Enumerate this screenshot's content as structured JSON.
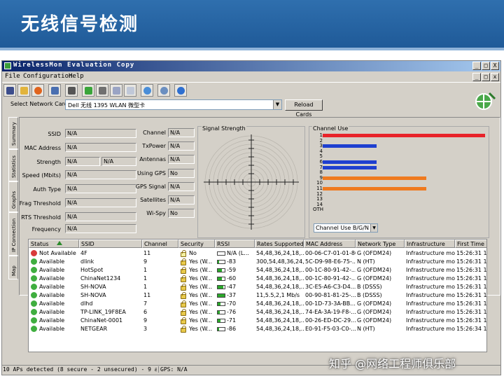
{
  "banner": {
    "title": "无线信号检测"
  },
  "window": {
    "title": "WirelessMon Evaluation Copy",
    "controls": [
      "_",
      "□",
      "X"
    ]
  },
  "menu": {
    "items": [
      "File",
      "Configuration",
      "Help"
    ]
  },
  "network_card": {
    "label": "Select Network Card",
    "value": "Dell 无线 1395 WLAN 微型卡",
    "reload_label": "Reload Cards"
  },
  "tabs": [
    "Summary",
    "Statistics",
    "Graphs",
    "IP Connection",
    "Map"
  ],
  "summary": {
    "left_fields": [
      {
        "label": "SSID",
        "value": "N/A"
      },
      {
        "label": "MAC Address",
        "value": "N/A"
      },
      {
        "label": "Strength",
        "value": "N/A",
        "value2": "N/A"
      },
      {
        "label": "Speed (Mbits)",
        "value": "N/A"
      },
      {
        "label": "Auth Type",
        "value": "N/A"
      },
      {
        "label": "Frag Threshold",
        "value": "N/A"
      },
      {
        "label": "RTS Threshold",
        "value": "N/A"
      },
      {
        "label": "Frequency",
        "value": "N/A"
      }
    ],
    "mid_fields": [
      {
        "label": "Channel",
        "value": "N/A"
      },
      {
        "label": "TxPower",
        "value": "N/A"
      },
      {
        "label": "Antennas",
        "value": "N/A"
      },
      {
        "label": "Using GPS",
        "value": "No"
      },
      {
        "label": "GPS Signal",
        "value": "N/A"
      },
      {
        "label": "Satellites",
        "value": "N/A"
      },
      {
        "label": "Wi-Spy",
        "value": "No"
      }
    ]
  },
  "signal_strength": {
    "label": "Signal Strength"
  },
  "channel_use": {
    "label": "Channel Use",
    "channels": [
      "1",
      "2",
      "3",
      "4",
      "5",
      "6",
      "7",
      "8",
      "9",
      "10",
      "11",
      "12",
      "13",
      "14",
      "OTH"
    ],
    "bars": [
      {
        "channel": "1",
        "fraction": 1.0,
        "color": "#e8232a"
      },
      {
        "channel": "3",
        "fraction": 0.33,
        "color": "#1e3fd0"
      },
      {
        "channel": "6",
        "fraction": 0.33,
        "color": "#1e3fd0"
      },
      {
        "channel": "7",
        "fraction": 0.33,
        "color": "#1e3fd0"
      },
      {
        "channel": "9",
        "fraction": 0.64,
        "color": "#ef7a1f"
      },
      {
        "channel": "11",
        "fraction": 0.64,
        "color": "#ef7a1f"
      }
    ],
    "mode_select": "Channel Use B/G/N"
  },
  "ap_list": {
    "columns": [
      "Status",
      "SSID",
      "Channel",
      "Security",
      "RSSI",
      "Rates Supported",
      "MAC Address",
      "Network Type",
      "Infrastructure",
      "First Time Se"
    ],
    "rows": [
      {
        "status": "Not Available",
        "status_color": "#d83a3a",
        "ssid": "4F",
        "channel": "11",
        "security": "No",
        "locked": false,
        "rssi": "N/A (L...",
        "rssi_level": 0,
        "rates": "54,48,36,24,18,...",
        "mac": "00-06-C7-01-01-86",
        "type": "G (OFDM24)",
        "infra": "Infrastructure mo...",
        "first": "15:26:31 16"
      },
      {
        "status": "Available",
        "status_color": "#3fae3f",
        "ssid": "dlink",
        "channel": "9",
        "security": "Yes (W...",
        "locked": true,
        "rssi": "-83",
        "rssi_level": 0.2,
        "rates": "300,54,48,36,24,...",
        "mac": "5C-D9-98-E6-75-...",
        "type": "N (HT)",
        "infra": "Infrastructure mo...",
        "first": "15:26:31 16"
      },
      {
        "status": "Available",
        "status_color": "#3fae3f",
        "ssid": "HotSpot",
        "channel": "1",
        "security": "Yes (W...",
        "locked": true,
        "rssi": "-59",
        "rssi_level": 0.6,
        "rates": "54,48,36,24,18,...",
        "mac": "00-1C-80-91-42-...",
        "type": "G (OFDM24)",
        "infra": "Infrastructure mo...",
        "first": "15:26:31 16"
      },
      {
        "status": "Available",
        "status_color": "#3fae3f",
        "ssid": "ChinaNet1234",
        "channel": "1",
        "security": "Yes (W...",
        "locked": true,
        "rssi": "-60",
        "rssi_level": 0.6,
        "rates": "54,48,36,24,18,...",
        "mac": "00-1C-80-91-42-...",
        "type": "G (OFDM24)",
        "infra": "Infrastructure mo...",
        "first": "15:26:31 16"
      },
      {
        "status": "Available",
        "status_color": "#3fae3f",
        "ssid": "SH-NOVA",
        "channel": "1",
        "security": "Yes (W...",
        "locked": true,
        "rssi": "-47",
        "rssi_level": 0.8,
        "rates": "54,48,36,24,18,...",
        "mac": "3C-E5-A6-C3-D4...",
        "type": "B (DSSS)",
        "infra": "Infrastructure mo...",
        "first": "15:26:31 16"
      },
      {
        "status": "Available",
        "status_color": "#3fae3f",
        "ssid": "SH-NOVA",
        "channel": "11",
        "security": "Yes (W...",
        "locked": true,
        "rssi": "-37",
        "rssi_level": 0.95,
        "rates": "11,5.5,2,1 Mb/s",
        "mac": "00-90-81-81-25-...",
        "type": "B (DSSS)",
        "infra": "Infrastructure mo...",
        "first": "15:26:31 16"
      },
      {
        "status": "Available",
        "status_color": "#3fae3f",
        "ssid": "dlhd",
        "channel": "7",
        "security": "Yes (W...",
        "locked": true,
        "rssi": "-70",
        "rssi_level": 0.4,
        "rates": "54,48,36,24,18,...",
        "mac": "00-1D-73-3A-BB...",
        "type": "G (OFDM24)",
        "infra": "Infrastructure mo...",
        "first": "15:26:31 16"
      },
      {
        "status": "Available",
        "status_color": "#3fae3f",
        "ssid": "TP-LINK_19F8EA",
        "channel": "6",
        "security": "Yes (W...",
        "locked": true,
        "rssi": "-76",
        "rssi_level": 0.3,
        "rates": "54,48,36,24,18,...",
        "mac": "74-EA-3A-19-F8-...",
        "type": "G (OFDM24)",
        "infra": "Infrastructure mo...",
        "first": "15:26:31 16"
      },
      {
        "status": "Available",
        "status_color": "#3fae3f",
        "ssid": "ChinaNet-0001",
        "channel": "9",
        "security": "Yes (W...",
        "locked": true,
        "rssi": "-71",
        "rssi_level": 0.35,
        "rates": "54,48,36,24,18,...",
        "mac": "00-26-ED-DC-29...",
        "type": "G (OFDM24)",
        "infra": "Infrastructure mo...",
        "first": "15:26:31 16"
      },
      {
        "status": "Available",
        "status_color": "#3fae3f",
        "ssid": "NETGEAR",
        "channel": "3",
        "security": "Yes (W...",
        "locked": true,
        "rssi": "-86",
        "rssi_level": 0.15,
        "rates": "54,48,36,24,18,...",
        "mac": "E0-91-F5-03-C0-...",
        "type": "N (HT)",
        "infra": "Infrastructure mo...",
        "first": "15:26:34 16"
      }
    ]
  },
  "status_bar": {
    "left": "10 APs detected (8 secure - 2 unsecured) - 9 avail",
    "right": "GPS: N/A"
  },
  "watermark": "知乎 @网络工程师俱乐部"
}
